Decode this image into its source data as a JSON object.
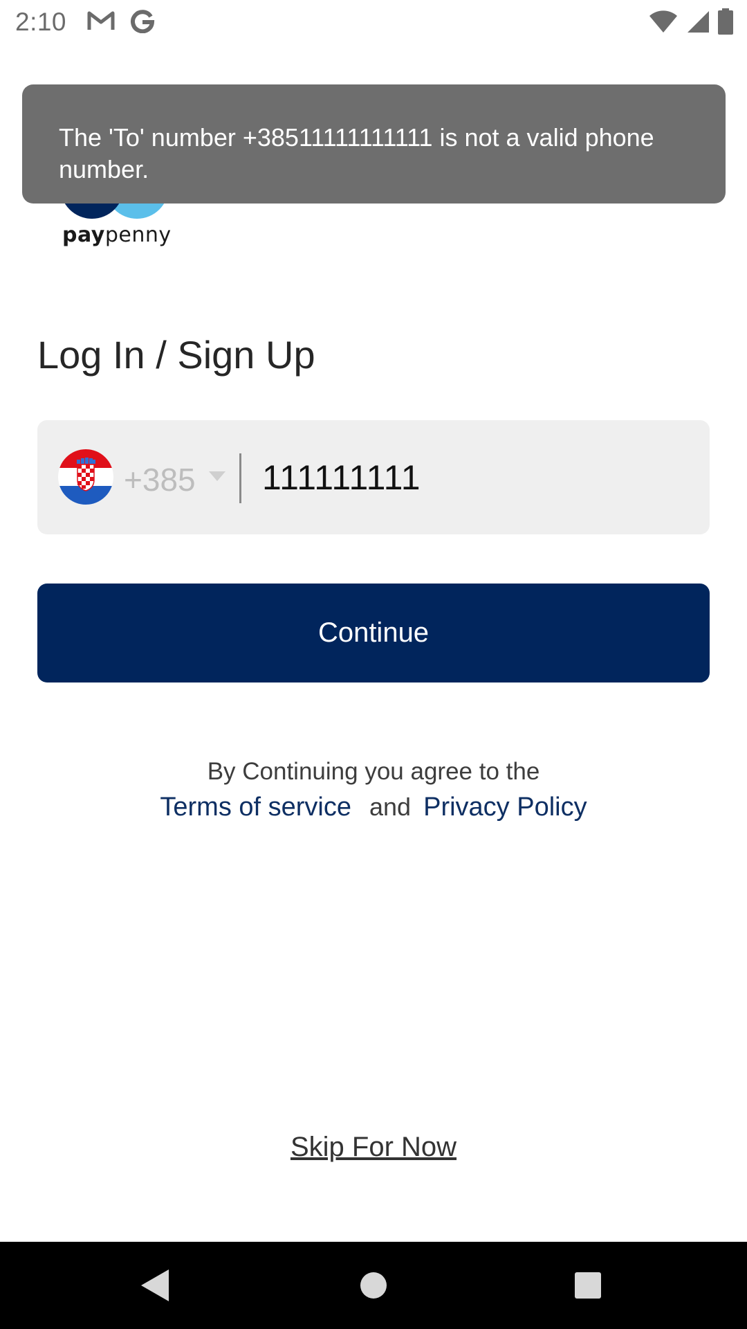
{
  "status_bar": {
    "time": "2:10",
    "left_icons": [
      "gmail-icon",
      "google-icon"
    ],
    "right_icons": [
      "wifi-icon",
      "signal-icon",
      "battery-icon"
    ]
  },
  "toast": {
    "message": "The 'To' number +38511111111111 is not a valid phone number."
  },
  "logo": {
    "bold": "pay",
    "regular": "penny",
    "colors": {
      "dark": "#01255c",
      "light": "#5bbfea"
    }
  },
  "form": {
    "heading": "Log In / Sign Up",
    "country": {
      "flag": "croatia-flag-icon",
      "code": "+385"
    },
    "phone_value": "111111111",
    "continue_label": "Continue"
  },
  "terms": {
    "line1": "By Continuing you agree to the",
    "terms_link": "Terms of service",
    "and": "and",
    "privacy_link": "Privacy Policy"
  },
  "skip_label": "Skip For Now",
  "nav_bar": {
    "items": [
      "back-icon",
      "home-icon",
      "recents-icon"
    ]
  },
  "colors": {
    "primary": "#01255c",
    "toast_bg": "#6e6e6e",
    "field_bg": "#efefef",
    "link": "#0e2f63"
  }
}
